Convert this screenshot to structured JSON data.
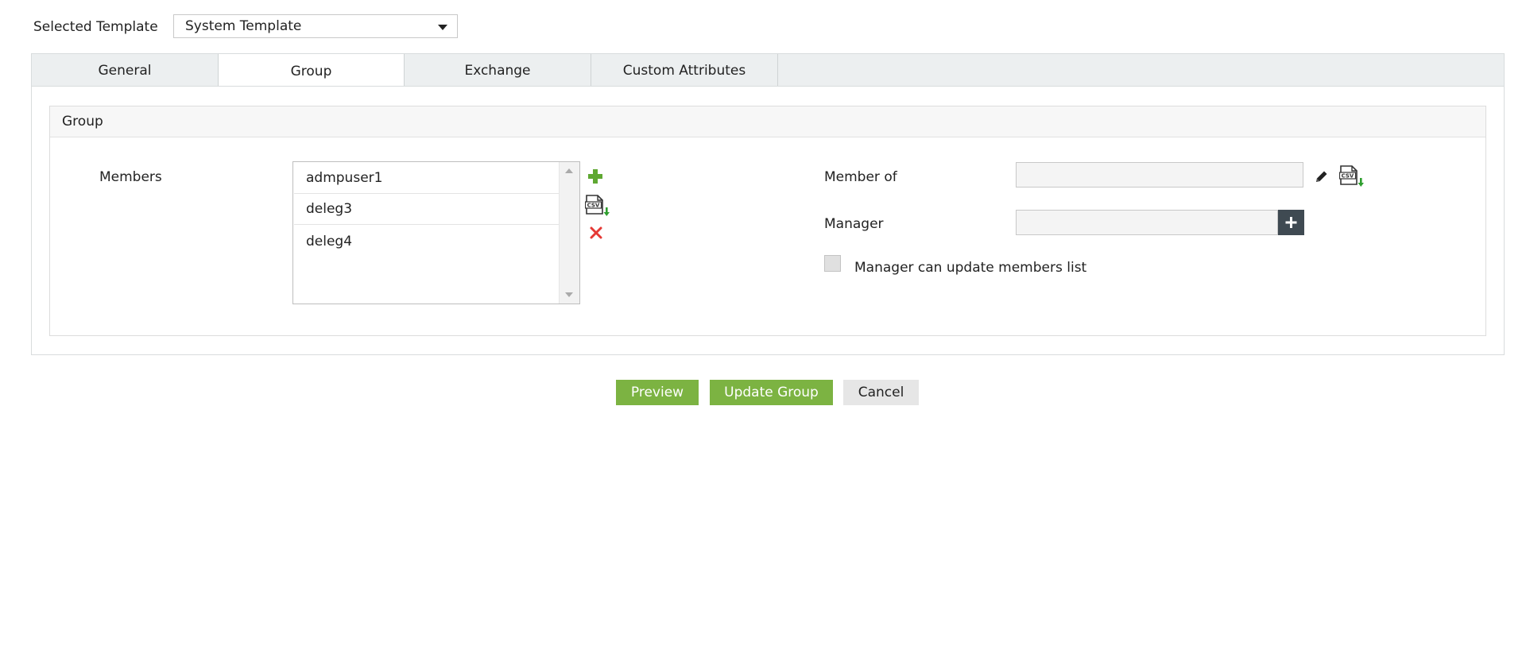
{
  "template": {
    "label": "Selected Template",
    "value": "System Template"
  },
  "tabs": [
    {
      "label": "General"
    },
    {
      "label": "Group"
    },
    {
      "label": "Exchange"
    },
    {
      "label": "Custom Attributes"
    }
  ],
  "active_tab": "Group",
  "panel": {
    "title": "Group",
    "members_label": "Members",
    "members": [
      "admpuser1",
      "deleg3",
      "deleg4"
    ],
    "member_of_label": "Member of",
    "member_of_value": "",
    "manager_label": "Manager",
    "manager_value": "",
    "manager_update_label": "Manager can update members list",
    "manager_update_checked": false
  },
  "buttons": {
    "preview": "Preview",
    "update": "Update Group",
    "cancel": "Cancel"
  },
  "colors": {
    "accent_green": "#7cb342",
    "add_icon_green": "#5fa832",
    "delete_red": "#e53935",
    "dark_button": "#3f4a52"
  },
  "icons": {
    "add": "plus-icon",
    "csv": "csv-import-icon",
    "delete": "close-icon",
    "edit": "pencil-icon"
  }
}
